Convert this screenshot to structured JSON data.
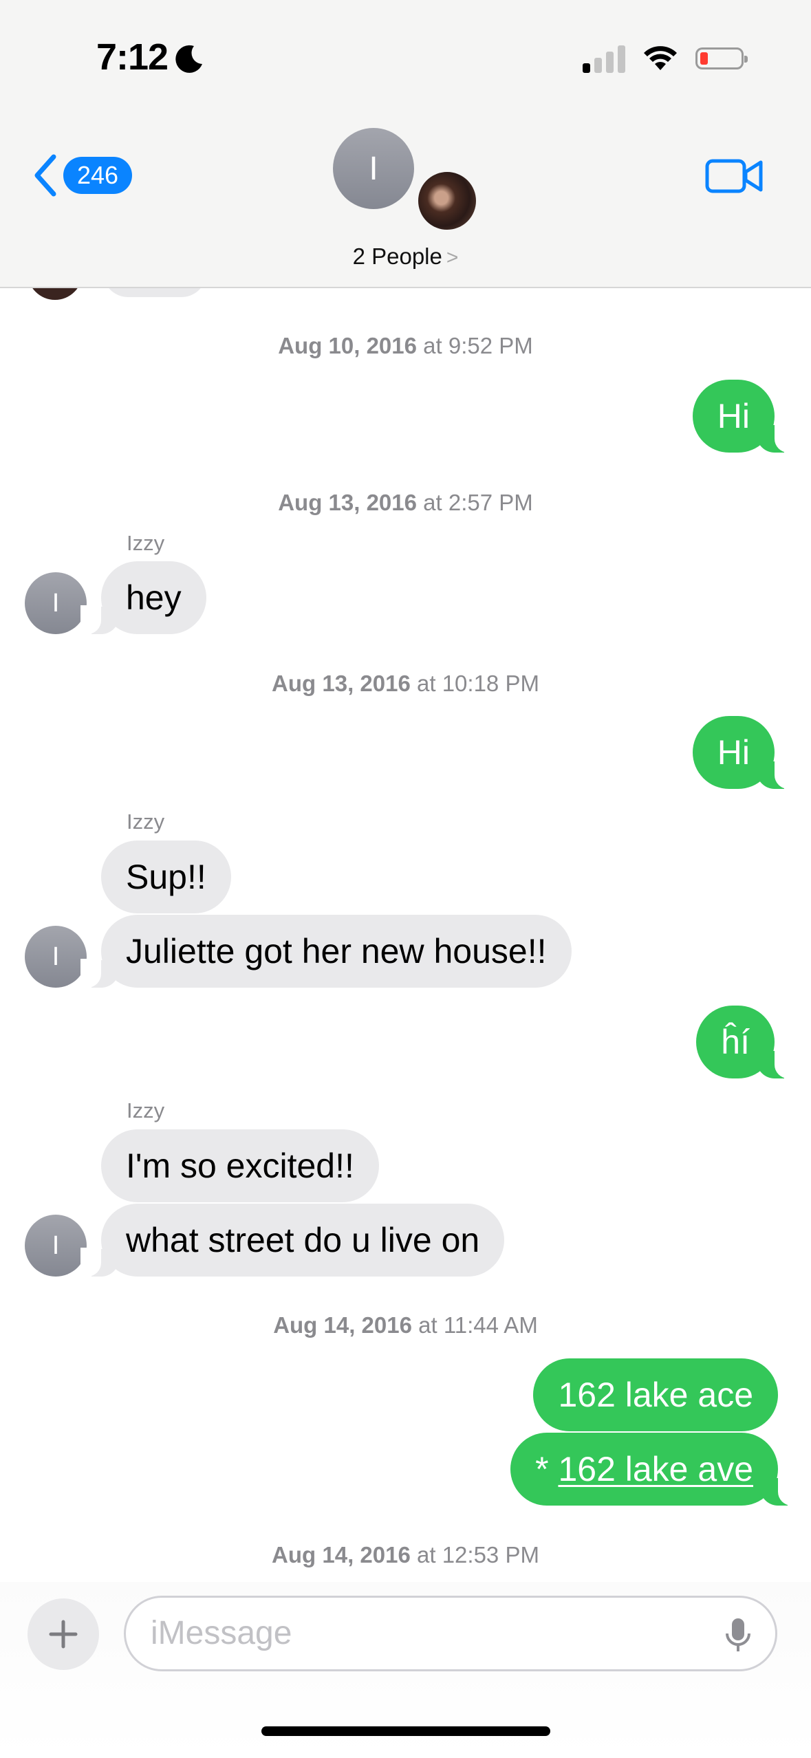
{
  "status_bar": {
    "time": "7:12"
  },
  "header": {
    "back_badge": "246",
    "group_initial": "I",
    "people_label": "2 People",
    "people_chevron": ">"
  },
  "messages": {
    "ts1": {
      "date": "Aug 10, 2016",
      "time": "at 9:52 PM"
    },
    "m1": "Hi",
    "ts2": {
      "date": "Aug 13, 2016",
      "time": "at 2:57 PM"
    },
    "sender1": "Izzy",
    "m2": "hey",
    "ts3": {
      "date": "Aug 13, 2016",
      "time": "at 10:18 PM"
    },
    "m3": "Hi",
    "sender2": "Izzy",
    "m4": "Sup!!",
    "m5": "Juliette got her new house!!",
    "m6": "ĥí",
    "sender3": "Izzy",
    "m7": "I'm so excited!!",
    "m8": "what street do u live on",
    "ts4": {
      "date": "Aug 14, 2016",
      "time": "at 11:44 AM"
    },
    "m9": "162 lake ace",
    "m10_prefix": "* ",
    "m10_link": "162 lake ave",
    "ts5": {
      "date": "Aug 14, 2016",
      "time": "at 12:53 PM"
    },
    "avatar_initial": "I"
  },
  "composer": {
    "placeholder": "iMessage"
  },
  "colors": {
    "sms_green": "#34c759",
    "incoming_gray": "#e9e9eb",
    "ios_blue": "#0a84ff",
    "battery_red": "#ff3b30"
  },
  "icons": [
    "moon-icon",
    "signal-icon",
    "wifi-icon",
    "battery-icon",
    "back-chevron-icon",
    "video-camera-icon",
    "plus-icon",
    "microphone-icon"
  ]
}
